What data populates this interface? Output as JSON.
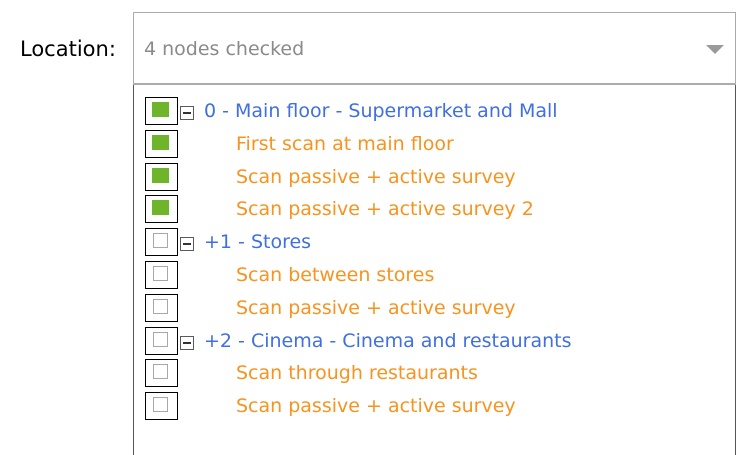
{
  "location": {
    "label": "Location:",
    "summary_text": "4 nodes checked",
    "dropdown_icon": "chevron-down-icon"
  },
  "tree": {
    "rows": [
      {
        "label": "0 - Main floor - Supermarket and Mall",
        "type": "group",
        "checked": true,
        "expanded": true
      },
      {
        "label": "First scan at main floor",
        "type": "child",
        "checked": true
      },
      {
        "label": "Scan passive + active survey",
        "type": "child",
        "checked": true
      },
      {
        "label": "Scan passive + active survey 2",
        "type": "child",
        "checked": true
      },
      {
        "label": "+1 - Stores",
        "type": "group",
        "checked": false,
        "expanded": true
      },
      {
        "label": "Scan between stores",
        "type": "child",
        "checked": false
      },
      {
        "label": "Scan passive + active survey",
        "type": "child",
        "checked": false
      },
      {
        "label": "+2 - Cinema - Cinema and restaurants",
        "type": "group",
        "checked": false,
        "expanded": true
      },
      {
        "label": "Scan through restaurants",
        "type": "child",
        "checked": false
      },
      {
        "label": "Scan passive + active survey",
        "type": "child",
        "checked": false
      }
    ]
  },
  "colors": {
    "group_text": "#3f6fe0",
    "child_text": "#f7931e",
    "check_fill": "#6eb52b"
  }
}
